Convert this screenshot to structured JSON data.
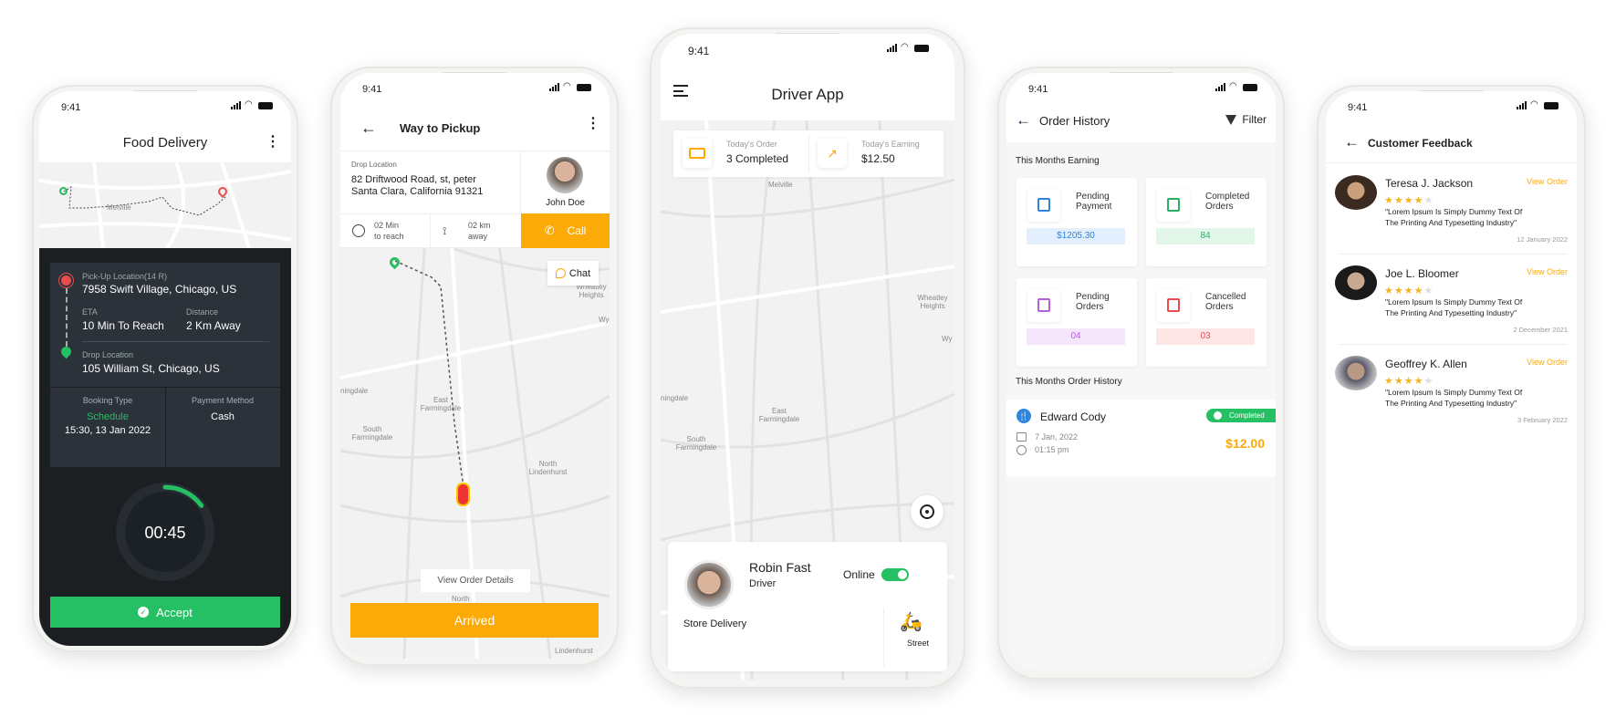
{
  "status_time": "9:41",
  "colors": {
    "green": "#25c063",
    "orange": "#fbaa07",
    "dark": "#1c1f22",
    "card_dark": "#2b323a",
    "red": "#e84c4c",
    "blue": "#2e86de",
    "purple": "#b65ee0"
  },
  "food_delivery": {
    "title": "Food Delivery",
    "map_label": "Melville",
    "pickup_label": "Pick-Up Location(14 R)",
    "pickup_address": "7958 Swift Village, Chicago, US",
    "eta_label": "ETA",
    "eta_value": "10 Min To Reach",
    "distance_label": "Distance",
    "distance_value": "2 Km Away",
    "drop_label": "Drop Location",
    "drop_address": "105 William St, Chicago, US",
    "booking_type_label": "Booking Type",
    "booking_type_value": "Schedule",
    "booking_time": "15:30, 13 Jan 2022",
    "payment_label": "Payment Method",
    "payment_value": "Cash",
    "timer": "00:45",
    "timer_progress": 0.15,
    "accept_label": "Accept"
  },
  "way_to_pickup": {
    "title": "Way to Pickup",
    "drop_label": "Drop Location",
    "drop_line1": "82  Driftwood Road, st, peter",
    "drop_line2": "Santa Clara, California 91321",
    "contact_name": "John Doe",
    "time_value": "02 Min",
    "time_sub": "to reach",
    "distance_value": "02 km",
    "distance_sub": "away",
    "call_label": "Call",
    "chat_label": "Chat",
    "map_labels": [
      "Wheatley Heights",
      "East Farmingdale",
      "South Farmingdale",
      "North Lindenhurst",
      "ningdale",
      "Lindenhurst",
      "North",
      "Wya"
    ],
    "view_details_label": "View Order Details",
    "arrived_label": "Arrived"
  },
  "driver_app": {
    "title": "Driver App",
    "order_label": "Today's Order",
    "order_value": "3 Completed",
    "earning_label": "Today's Earning",
    "earning_value": "$12.50",
    "map_labels": [
      "Melville",
      "Wheatley Heights",
      "East Farmingdale",
      "South Farmingdale",
      "ningdale",
      "Wy"
    ],
    "driver_name": "Robin Fast",
    "driver_role": "Driver",
    "online_label": "Online",
    "online": true,
    "delivery_type": "Store Delivery",
    "vehicle_label": "Street"
  },
  "order_history": {
    "title": "Order History",
    "filter_label": "Filter",
    "earning_section": "This Months Earning",
    "stats": [
      {
        "label1": "Pending",
        "label2": "Payment",
        "value": "$1205.30",
        "color": "#2e86de",
        "bg": "#e3effc"
      },
      {
        "label1": "Completed",
        "label2": "Orders",
        "value": "84",
        "color": "#25b065",
        "bg": "#e3f6ea"
      },
      {
        "label1": "Pending",
        "label2": "Orders",
        "value": "04",
        "color": "#b65ee0",
        "bg": "#f5e6fc"
      },
      {
        "label1": "Cancelled",
        "label2": "Orders",
        "value": "03",
        "color": "#e84c4c",
        "bg": "#fde6e6"
      }
    ],
    "history_section": "This Months Order History",
    "order": {
      "name": "Edward Cody",
      "status": "Completed",
      "date": "7 Jan, 2022",
      "time": "01:15 pm",
      "amount": "$12.00"
    }
  },
  "customer_feedback": {
    "title": "Customer Feedback",
    "reviews": [
      {
        "name": "Teresa J. Jackson",
        "link": "View Order",
        "rating": 4,
        "text1": "\"Lorem Ipsum Is Simply Dummy Text Of",
        "text2": "The Printing And Typesetting Industry\"",
        "date": "12 January 2022"
      },
      {
        "name": "Joe L. Bloomer",
        "link": "View Order",
        "rating": 4,
        "text1": "\"Lorem Ipsum Is Simply Dummy Text Of",
        "text2": "The Printing And Typesetting Industry\"",
        "date": "2 December 2021"
      },
      {
        "name": "Geoffrey K. Allen",
        "link": "View Order",
        "rating": 4,
        "text1": "\"Lorem Ipsum Is Simply Dummy Text Of",
        "text2": "The Printing And Typesetting Industry\"",
        "date": "3 February 2022"
      }
    ]
  }
}
